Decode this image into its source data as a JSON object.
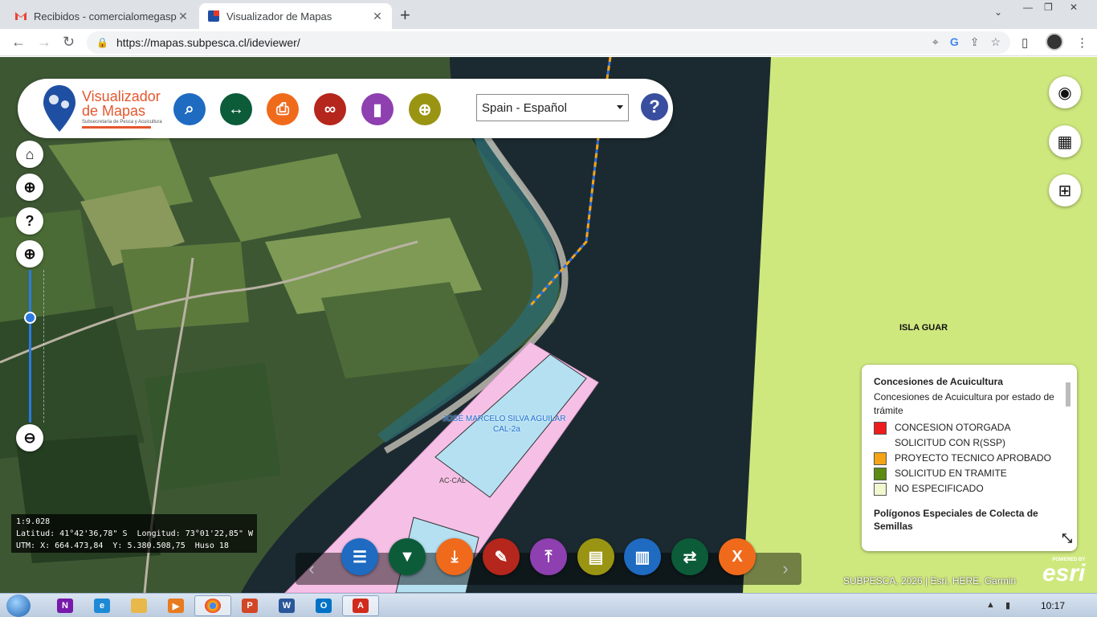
{
  "browser": {
    "tabs": [
      {
        "title": "Recibidos - comercialomegaspa@",
        "favicon": "gmail-icon",
        "active": false
      },
      {
        "title": "Visualizador de Mapas",
        "favicon": "subpesca-icon",
        "active": true
      }
    ],
    "url": "https://mapas.subpesca.cl/ideviewer/"
  },
  "header": {
    "logo_title_line1": "Visualizador",
    "logo_title_line2": "de Mapas",
    "logo_subtitle": "Subsecretaría de Pesca y Acuicultura",
    "tools": [
      {
        "name": "search-icon",
        "color": "#1e6bc1"
      },
      {
        "name": "measure-icon",
        "color": "#0c5c3a"
      },
      {
        "name": "print-icon",
        "color": "#f06a1c"
      },
      {
        "name": "link-icon",
        "color": "#b5261c"
      },
      {
        "name": "bookmark-icon",
        "color": "#8e3fb0"
      },
      {
        "name": "locate-icon",
        "color": "#9a9413"
      }
    ],
    "language": "Spain - Español",
    "help_icon": "question-icon"
  },
  "map": {
    "labels": {
      "isla": "ISLA GUAR",
      "concession_holder": "JOSÉ MARCELO SILVA AGUILAR",
      "concession_code": "CAL-2a",
      "ac_code": "AC-CAL-"
    },
    "coords": {
      "scale": "1:9.028",
      "latlon": "Latitud: 41°42'36,78\" S  Longitud: 73°01'22,85\" W",
      "utm": "UTM: X: 664.473,84  Y: 5.380.508,75  Huso 18"
    }
  },
  "legend": {
    "title": "Concesiones de Acuicultura",
    "subtitle": "Concesiones de Acuicultura por estado de trámite",
    "items": [
      {
        "label": "CONCESION OTORGADA",
        "color": "#ee1c1c"
      },
      {
        "label": "SOLICITUD CON R(SSP)",
        "color": null
      },
      {
        "label": "PROYECTO TECNICO APROBADO",
        "color": "#f5a418"
      },
      {
        "label": "SOLICITUD EN TRAMITE",
        "color": "#5d8a12"
      },
      {
        "label": "NO ESPECIFICADO",
        "color": "#f0f8d0"
      }
    ],
    "title2": "Polígonos Especiales de Colecta de Semillas"
  },
  "bottom_tools": [
    {
      "name": "table-icon",
      "color": "#1e6bc1"
    },
    {
      "name": "filter-icon",
      "color": "#0c5c3a"
    },
    {
      "name": "download-icon",
      "color": "#f06a1c"
    },
    {
      "name": "draw-icon",
      "color": "#b5261c"
    },
    {
      "name": "upload-icon",
      "color": "#8e3fb0"
    },
    {
      "name": "book-icon",
      "color": "#9a9413"
    },
    {
      "name": "chart-icon",
      "color": "#1e6bc1"
    },
    {
      "name": "swap-icon",
      "color": "#0c5c3a"
    },
    {
      "name": "excel-icon",
      "color": "#f06a1c"
    }
  ],
  "attribution": "SUBPESCA, 2026 | Esri, HERE, Garmin",
  "esri": {
    "powered_by": "POWERED BY",
    "brand": "esri"
  },
  "taskbar": {
    "apps": [
      "onenote",
      "ie",
      "explorer",
      "media",
      "chrome",
      "powerpoint",
      "word",
      "outlook",
      "acrobat"
    ],
    "time": "10:17"
  }
}
